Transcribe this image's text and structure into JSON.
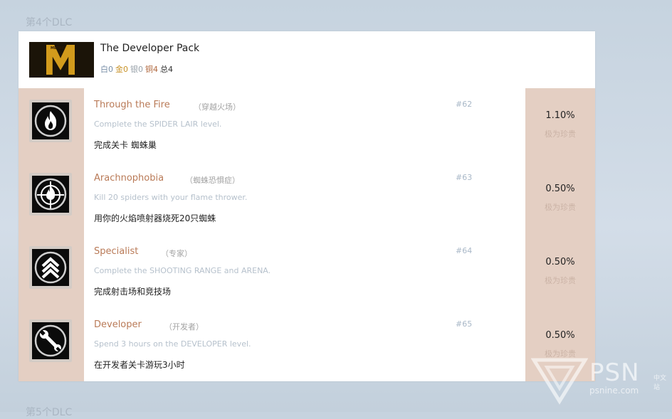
{
  "sections": {
    "top_title": "第4个DLC",
    "bottom_title": "第5个DLC"
  },
  "dlc": {
    "title": "The Developer Pack",
    "cover_text": "METRO",
    "stats": {
      "white": "白0",
      "gold": "金0",
      "silver": "银0",
      "bronze": "铜4",
      "total": "总4"
    }
  },
  "trophies": [
    {
      "name": "Through the Fire",
      "cn_name": "（穿越火场）",
      "desc": "Complete the SPIDER LAIR level.",
      "zh_desc": "完成关卡 蜘蛛巢",
      "number": "#62",
      "rate": "1.10%",
      "rarity": "极为珍贵",
      "icon": "flame-icon"
    },
    {
      "name": "Arachnophobia",
      "cn_name": "（蜘蛛恐惧症）",
      "desc": "Kill 20 spiders with your flame thrower.",
      "zh_desc": "用你的火焰喷射器烧死20只蜘蛛",
      "number": "#63",
      "rate": "0.50%",
      "rarity": "极为珍贵",
      "icon": "crosshair-flame-icon"
    },
    {
      "name": "Specialist",
      "cn_name": "（专家）",
      "desc": "Complete the SHOOTING RANGE and ARENA.",
      "zh_desc": "完成射击场和竞技场",
      "number": "#64",
      "rate": "0.50%",
      "rarity": "极为珍贵",
      "icon": "chevrons-up-icon"
    },
    {
      "name": "Developer",
      "cn_name": "（开发者）",
      "desc": "Spend 3 hours on the DEVELOPER level.",
      "zh_desc": "在开发者关卡游玩3小时",
      "number": "#65",
      "rate": "0.50%",
      "rarity": "极为珍贵",
      "icon": "wrench-icon"
    }
  ],
  "watermark": {
    "brand": "PSN",
    "suffix": "中文站",
    "url": "psnine.com"
  }
}
